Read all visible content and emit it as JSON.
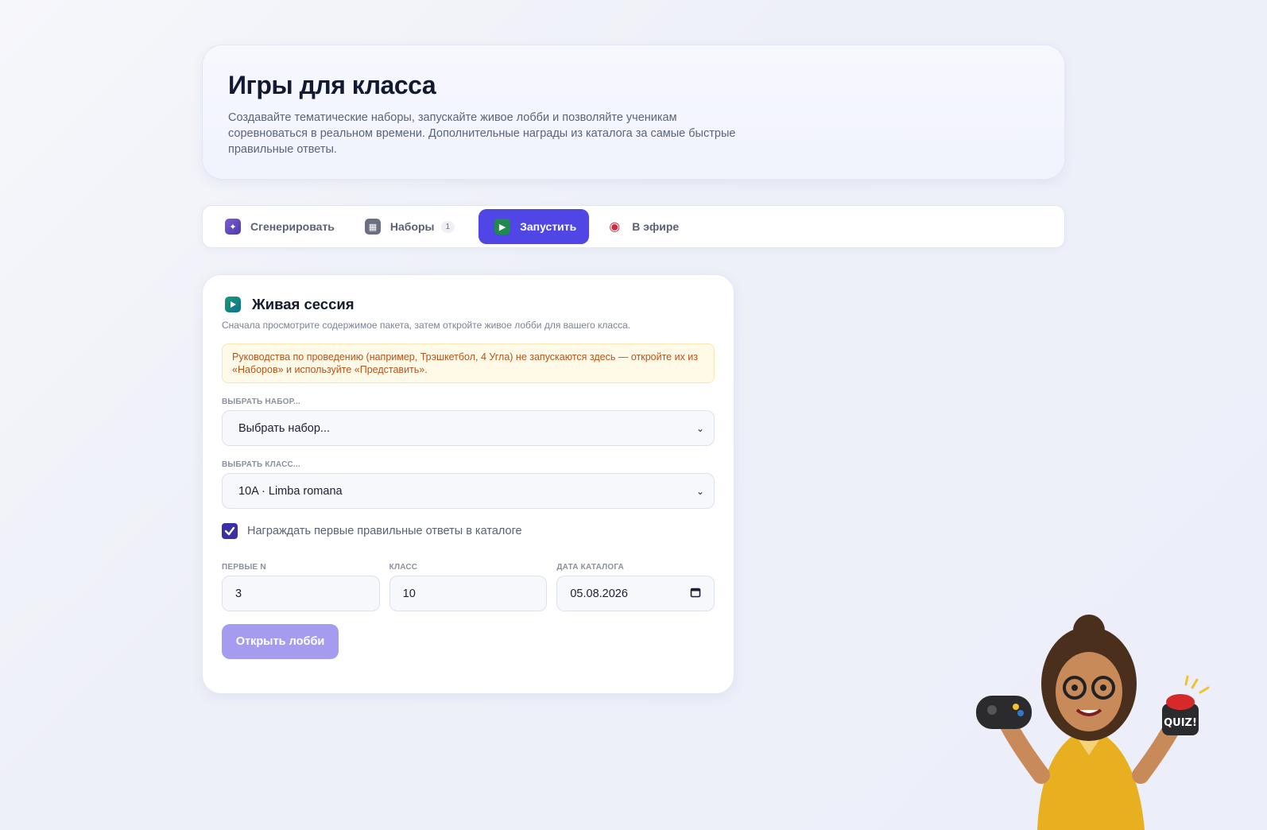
{
  "header": {
    "title": "Игры для класса",
    "subtitle": "Создавайте тематические наборы, запускайте живое лобби и позволяйте ученикам соревноваться в реальном времени. Дополнительные награды из каталога за самые быстрые правильные ответы."
  },
  "tabs": [
    {
      "label": "Сгенерировать",
      "icon": "sparkle-icon"
    },
    {
      "label": "Наборы",
      "icon": "grid-icon",
      "badge": "1"
    },
    {
      "label": "Запустить",
      "icon": "play-icon",
      "active": true
    },
    {
      "label": "В эфире",
      "icon": "broadcast-icon"
    }
  ],
  "session": {
    "title": "Живая сессия",
    "description": "Сначала просмотрите содержимое пакета, затем откройте живое лобби для вашего класса.",
    "warning": "Руководства по проведению (например, Трэшкетбол, 4 Угла) не запускаются здесь — откройте их из «Наборов» и используйте «Представить».",
    "set_label": "Выбрать набор...",
    "set_value": "Выбрать набор...",
    "class_label": "Выбрать класс...",
    "class_value": "10A · Limba romana",
    "reward_label": "Награждать первые правильные ответы в каталоге",
    "reward_checked": true,
    "first_n_label": "Первые N",
    "first_n_value": "3",
    "grade_label": "Класс",
    "grade_value": "10",
    "date_label": "Дата каталога",
    "date_value": "05.08.2026",
    "open_button": "Открыть лобби"
  },
  "colors": {
    "accent": "#4f46e5",
    "checkbox": "#3b2fa8",
    "disabled_button": "#a59cf0",
    "warning_text": "#b4541a"
  }
}
